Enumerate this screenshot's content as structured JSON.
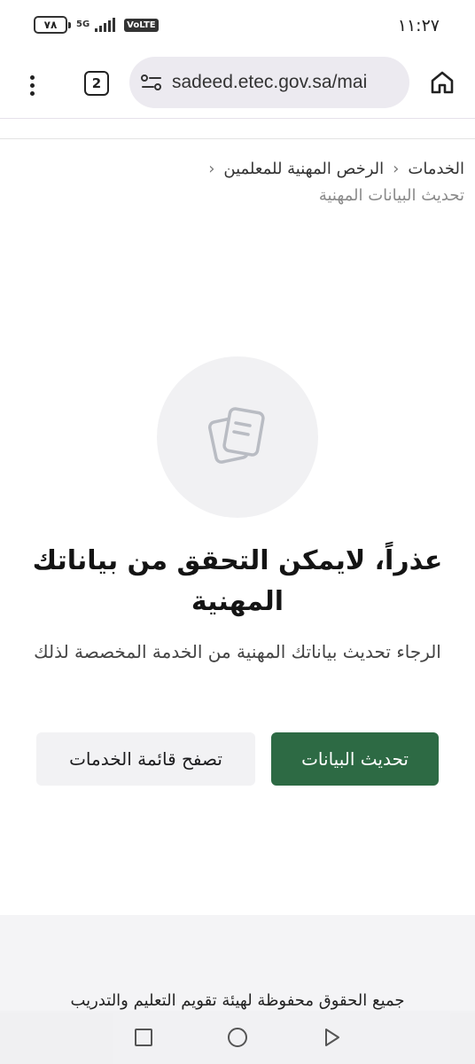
{
  "status_bar": {
    "time": "١١:٢٧",
    "battery": "٧٨",
    "network": "5G",
    "volte": "VoLTE"
  },
  "browser": {
    "url": "sadeed.etec.gov.sa/mai",
    "tab_count": "2"
  },
  "breadcrumb": {
    "items": [
      "الخدمات",
      "الرخص المهنية للمعلمين"
    ],
    "current": "تحديث البيانات المهنية"
  },
  "empty_state": {
    "icon": "documents-icon",
    "title": "عذراً، لايمكن التحقق من بياناتك المهنية",
    "message": "الرجاء تحديث بياناتك المهنية من الخدمة المخصصة لذلك"
  },
  "actions": {
    "primary_label": "تحديث البيانات",
    "secondary_label": "تصفح قائمة الخدمات"
  },
  "footer": {
    "copyright": "جميع الحقوق محفوظة لهيئة تقويم التعليم والتدريب"
  },
  "colors": {
    "primary": "#2d6a44",
    "secondary_bg": "#f2f2f4",
    "icon_circle": "#f1f1f3"
  }
}
